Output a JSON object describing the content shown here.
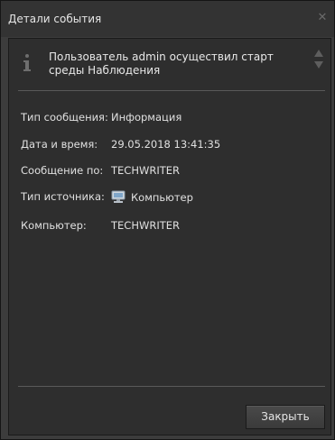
{
  "window": {
    "title": "Детали события",
    "close_glyph": "✕"
  },
  "message": {
    "icon": "info-icon",
    "text": "Пользователь admin осуществил старт среды Наблюдения"
  },
  "details": [
    {
      "label": "Тип сообщения:",
      "value": "Информация"
    },
    {
      "label": "Дата и время:",
      "value": "29.05.2018 13:41:35"
    },
    {
      "label": "Сообщение по:",
      "value": "TECHWRITER"
    },
    {
      "label": "Тип источника:",
      "value": "Компьютер",
      "icon": "computer-icon"
    },
    {
      "label": "Компьютер:",
      "value": "TECHWRITER"
    }
  ],
  "buttons": {
    "close_label": "Закрыть"
  },
  "colors": {
    "background": "#3c3c3c",
    "panel": "#2e2e2e",
    "text": "#e0e0e0"
  }
}
